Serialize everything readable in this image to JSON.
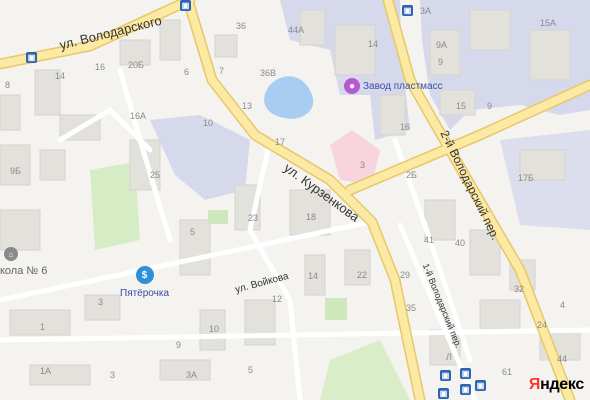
{
  "map": {
    "streets": [
      {
        "name": "ул. Володарского"
      },
      {
        "name": "ул. Курзенкова"
      },
      {
        "name": "ул. Войкова"
      },
      {
        "name": "2-й Володарский пер."
      },
      {
        "name": "1-й Володарский пер."
      }
    ],
    "pois": [
      {
        "name": "Завод пластмасс",
        "icon": "factory-icon",
        "color": "#b55ad1"
      },
      {
        "name": "Пятёрочка",
        "icon": "shopping-bag-icon",
        "color": "#2f8fd8"
      },
      {
        "name": "кола № 6",
        "icon": "school-icon",
        "color": "#8a8a8a"
      }
    ],
    "house_numbers": [
      "36",
      "44A",
      "3A",
      "15A",
      "14",
      "9A",
      "9",
      "20Б",
      "16",
      "6",
      "7",
      "36B",
      "8",
      "14",
      "16A",
      "10",
      "13",
      "15",
      "9",
      "17",
      "16",
      "9Б",
      "25",
      "3",
      "2Б",
      "17Б",
      "5",
      "23",
      "18",
      "41",
      "40",
      "14",
      "22",
      "29",
      "32",
      "12",
      "3",
      "1",
      "35",
      "10",
      "9",
      "5",
      "3A",
      "3",
      "1A",
      "4",
      "24",
      "61",
      "44",
      "Л"
    ],
    "colors": {
      "background": "#f4f3ef",
      "major_road": "#fce9a4",
      "road_border": "#e5c969",
      "building": "#e3e1dc",
      "industrial": "#d6d9ec",
      "park": "#d6ecc5",
      "water": "#a9cdf2",
      "hospital": "#f8d4df",
      "bus_stop": "#2d63b4"
    },
    "brand": {
      "prefix": "Я",
      "rest": "ндекс"
    }
  }
}
